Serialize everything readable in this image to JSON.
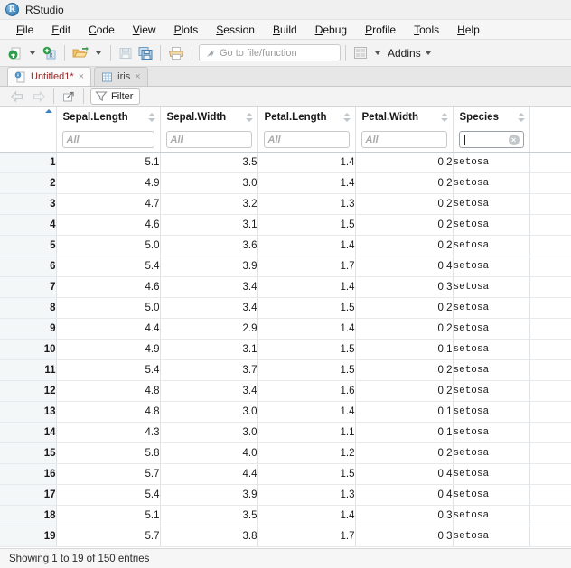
{
  "window": {
    "title": "RStudio",
    "logo_icon": "rstudio-logo-icon"
  },
  "menubar": {
    "items": [
      {
        "label": "File",
        "mnemonic": "F",
        "rest": "ile"
      },
      {
        "label": "Edit",
        "mnemonic": "E",
        "rest": "dit"
      },
      {
        "label": "Code",
        "mnemonic": "C",
        "rest": "ode"
      },
      {
        "label": "View",
        "mnemonic": "V",
        "rest": "iew"
      },
      {
        "label": "Plots",
        "mnemonic": "P",
        "rest": "lots"
      },
      {
        "label": "Session",
        "mnemonic": "S",
        "rest": "ession"
      },
      {
        "label": "Build",
        "mnemonic": "B",
        "rest": "uild"
      },
      {
        "label": "Debug",
        "mnemonic": "D",
        "rest": "ebug"
      },
      {
        "label": "Profile",
        "mnemonic": "P",
        "rest": "rofile"
      },
      {
        "label": "Tools",
        "mnemonic": "T",
        "rest": "ools"
      },
      {
        "label": "Help",
        "mnemonic": "H",
        "rest": "elp"
      }
    ]
  },
  "toolbar": {
    "new_file_icon": "new-file-icon",
    "new_project_icon": "new-project-r-icon",
    "open_file_icon": "open-folder-icon",
    "save_icon": "save-icon",
    "save_all_icon": "save-all-icon",
    "print_icon": "print-icon",
    "goto_icon": "goto-arrow-icon",
    "goto_placeholder": "Go to file/function",
    "panes_icon": "pane-layout-icon",
    "addins_label": "Addins"
  },
  "tabs": [
    {
      "label": "Untitled1*",
      "icon": "r-script-icon",
      "close": "×",
      "active": true
    },
    {
      "label": "iris",
      "icon": "data-grid-icon",
      "close": "×",
      "active": false
    }
  ],
  "table_toolbar": {
    "back_icon": "arrow-left-icon",
    "forward_icon": "arrow-right-icon",
    "popout_icon": "show-in-new-window-icon",
    "filter_icon": "funnel-icon",
    "filter_label": "Filter"
  },
  "table": {
    "rownum_sort": "ascending",
    "columns": [
      {
        "name": "Sepal.Length",
        "filter_placeholder": "All",
        "filter_value": "",
        "align": "num",
        "focused": false
      },
      {
        "name": "Sepal.Width",
        "filter_placeholder": "All",
        "filter_value": "",
        "align": "num",
        "focused": false
      },
      {
        "name": "Petal.Length",
        "filter_placeholder": "All",
        "filter_value": "",
        "align": "num",
        "focused": false
      },
      {
        "name": "Petal.Width",
        "filter_placeholder": "All",
        "filter_value": "",
        "align": "num",
        "focused": false
      },
      {
        "name": "Species",
        "filter_placeholder": "",
        "filter_value": "",
        "align": "txt",
        "focused": true
      }
    ],
    "rows": [
      {
        "n": "1",
        "c": [
          "5.1",
          "3.5",
          "1.4",
          "0.2",
          "setosa"
        ]
      },
      {
        "n": "2",
        "c": [
          "4.9",
          "3.0",
          "1.4",
          "0.2",
          "setosa"
        ]
      },
      {
        "n": "3",
        "c": [
          "4.7",
          "3.2",
          "1.3",
          "0.2",
          "setosa"
        ]
      },
      {
        "n": "4",
        "c": [
          "4.6",
          "3.1",
          "1.5",
          "0.2",
          "setosa"
        ]
      },
      {
        "n": "5",
        "c": [
          "5.0",
          "3.6",
          "1.4",
          "0.2",
          "setosa"
        ]
      },
      {
        "n": "6",
        "c": [
          "5.4",
          "3.9",
          "1.7",
          "0.4",
          "setosa"
        ]
      },
      {
        "n": "7",
        "c": [
          "4.6",
          "3.4",
          "1.4",
          "0.3",
          "setosa"
        ]
      },
      {
        "n": "8",
        "c": [
          "5.0",
          "3.4",
          "1.5",
          "0.2",
          "setosa"
        ]
      },
      {
        "n": "9",
        "c": [
          "4.4",
          "2.9",
          "1.4",
          "0.2",
          "setosa"
        ]
      },
      {
        "n": "10",
        "c": [
          "4.9",
          "3.1",
          "1.5",
          "0.1",
          "setosa"
        ]
      },
      {
        "n": "11",
        "c": [
          "5.4",
          "3.7",
          "1.5",
          "0.2",
          "setosa"
        ]
      },
      {
        "n": "12",
        "c": [
          "4.8",
          "3.4",
          "1.6",
          "0.2",
          "setosa"
        ]
      },
      {
        "n": "13",
        "c": [
          "4.8",
          "3.0",
          "1.4",
          "0.1",
          "setosa"
        ]
      },
      {
        "n": "14",
        "c": [
          "4.3",
          "3.0",
          "1.1",
          "0.1",
          "setosa"
        ]
      },
      {
        "n": "15",
        "c": [
          "5.8",
          "4.0",
          "1.2",
          "0.2",
          "setosa"
        ]
      },
      {
        "n": "16",
        "c": [
          "5.7",
          "4.4",
          "1.5",
          "0.4",
          "setosa"
        ]
      },
      {
        "n": "17",
        "c": [
          "5.4",
          "3.9",
          "1.3",
          "0.4",
          "setosa"
        ]
      },
      {
        "n": "18",
        "c": [
          "5.1",
          "3.5",
          "1.4",
          "0.3",
          "setosa"
        ]
      },
      {
        "n": "19",
        "c": [
          "5.7",
          "3.8",
          "1.7",
          "0.3",
          "setosa"
        ]
      }
    ]
  },
  "statusbar": {
    "text": "Showing 1 to 19 of 150 entries"
  },
  "colors": {
    "accent_blue": "#3b82c4",
    "tab_active_text": "#9b2424",
    "rownum_bg": "#f4f7f8",
    "grid_line": "#dfe3e6"
  }
}
